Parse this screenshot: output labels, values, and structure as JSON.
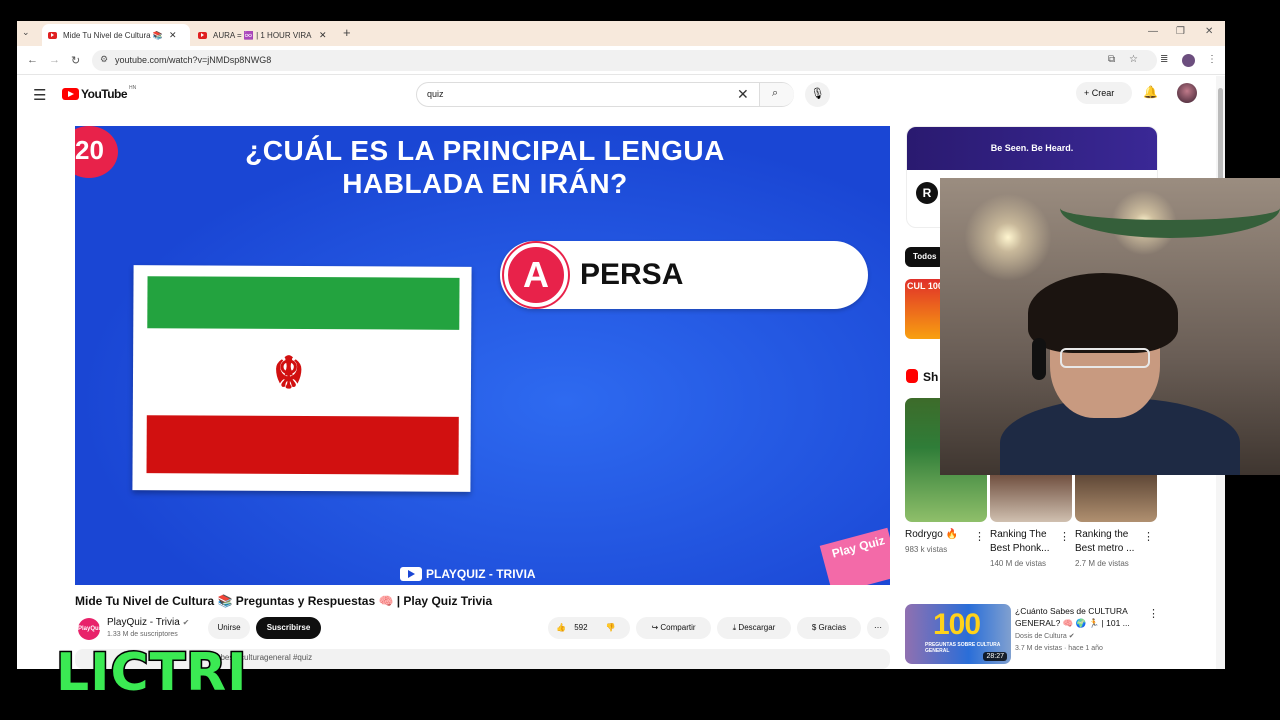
{
  "browser": {
    "tabs": [
      {
        "title": "Mide Tu Nivel de Cultura 📚 🔊",
        "active": true
      },
      {
        "title": "AURA = ♾️ | 1 HOUR VIRA 🔊",
        "active": false
      }
    ],
    "url": "youtube.com/watch?v=jNMDsp8NWG8"
  },
  "youtube": {
    "logo_text": "YouTube",
    "region": "HN",
    "search_value": "quiz",
    "create_label": "Crear"
  },
  "video": {
    "number": "20",
    "question": "¿CUÁL ES LA PRINCIPAL LENGUA HABLADA EN IRÁN?",
    "answer_letter": "A",
    "answer_text": "PERSA",
    "watermark": "PLAYQUIZ - TRIVIA",
    "sticker": "Play Quiz",
    "title": "Mide Tu Nivel de Cultura 📚 Preguntas y Respuestas 🧠 | Play Quiz Trivia",
    "channel": "PlayQuiz - Trivia",
    "channel_logo": "PlayQuiz",
    "subscribers": "1.33 M de suscriptores",
    "join_label": "Unirse",
    "subscribe_label": "Suscribirse",
    "likes": "592",
    "share_label": "Compartir",
    "download_label": "Descargar",
    "thanks_label": "Gracias",
    "description_snippet": "sabes #culturageneral #quiz"
  },
  "sidebar": {
    "ad_banner": "Be Seen. Be Heard.",
    "ad_logo": "R",
    "chip_all": "Todos",
    "thumb_text": "CUL 100",
    "shorts_label": "Sh",
    "shorts": [
      {
        "title": "Rodrygo 🔥",
        "views": "983 k vistas"
      },
      {
        "title": "Ranking The Best Phonk...",
        "views": "140 M de vistas"
      },
      {
        "title": "Ranking the Best metro ...",
        "views": "2.7 M de vistas"
      }
    ],
    "recommended": {
      "thumb_big": "100",
      "thumb_sub": "PREGUNTAS SOBRE CULTURA GENERAL",
      "duration": "28:27",
      "title": "¿Cuánto Sabes de CULTURA GENERAL? 🧠 🌍 🏃 | 101 ...",
      "channel": "Dosis de Cultura",
      "meta": "3.7 M de vistas · hace 1 año"
    }
  },
  "overlay": {
    "streamer_name": "LICTRI"
  },
  "colors": {
    "youtube_red": "#ff0000",
    "quiz_blue": "#1a46d4",
    "quiz_pink": "#e8224a",
    "lictri_green": "#3bea53"
  }
}
